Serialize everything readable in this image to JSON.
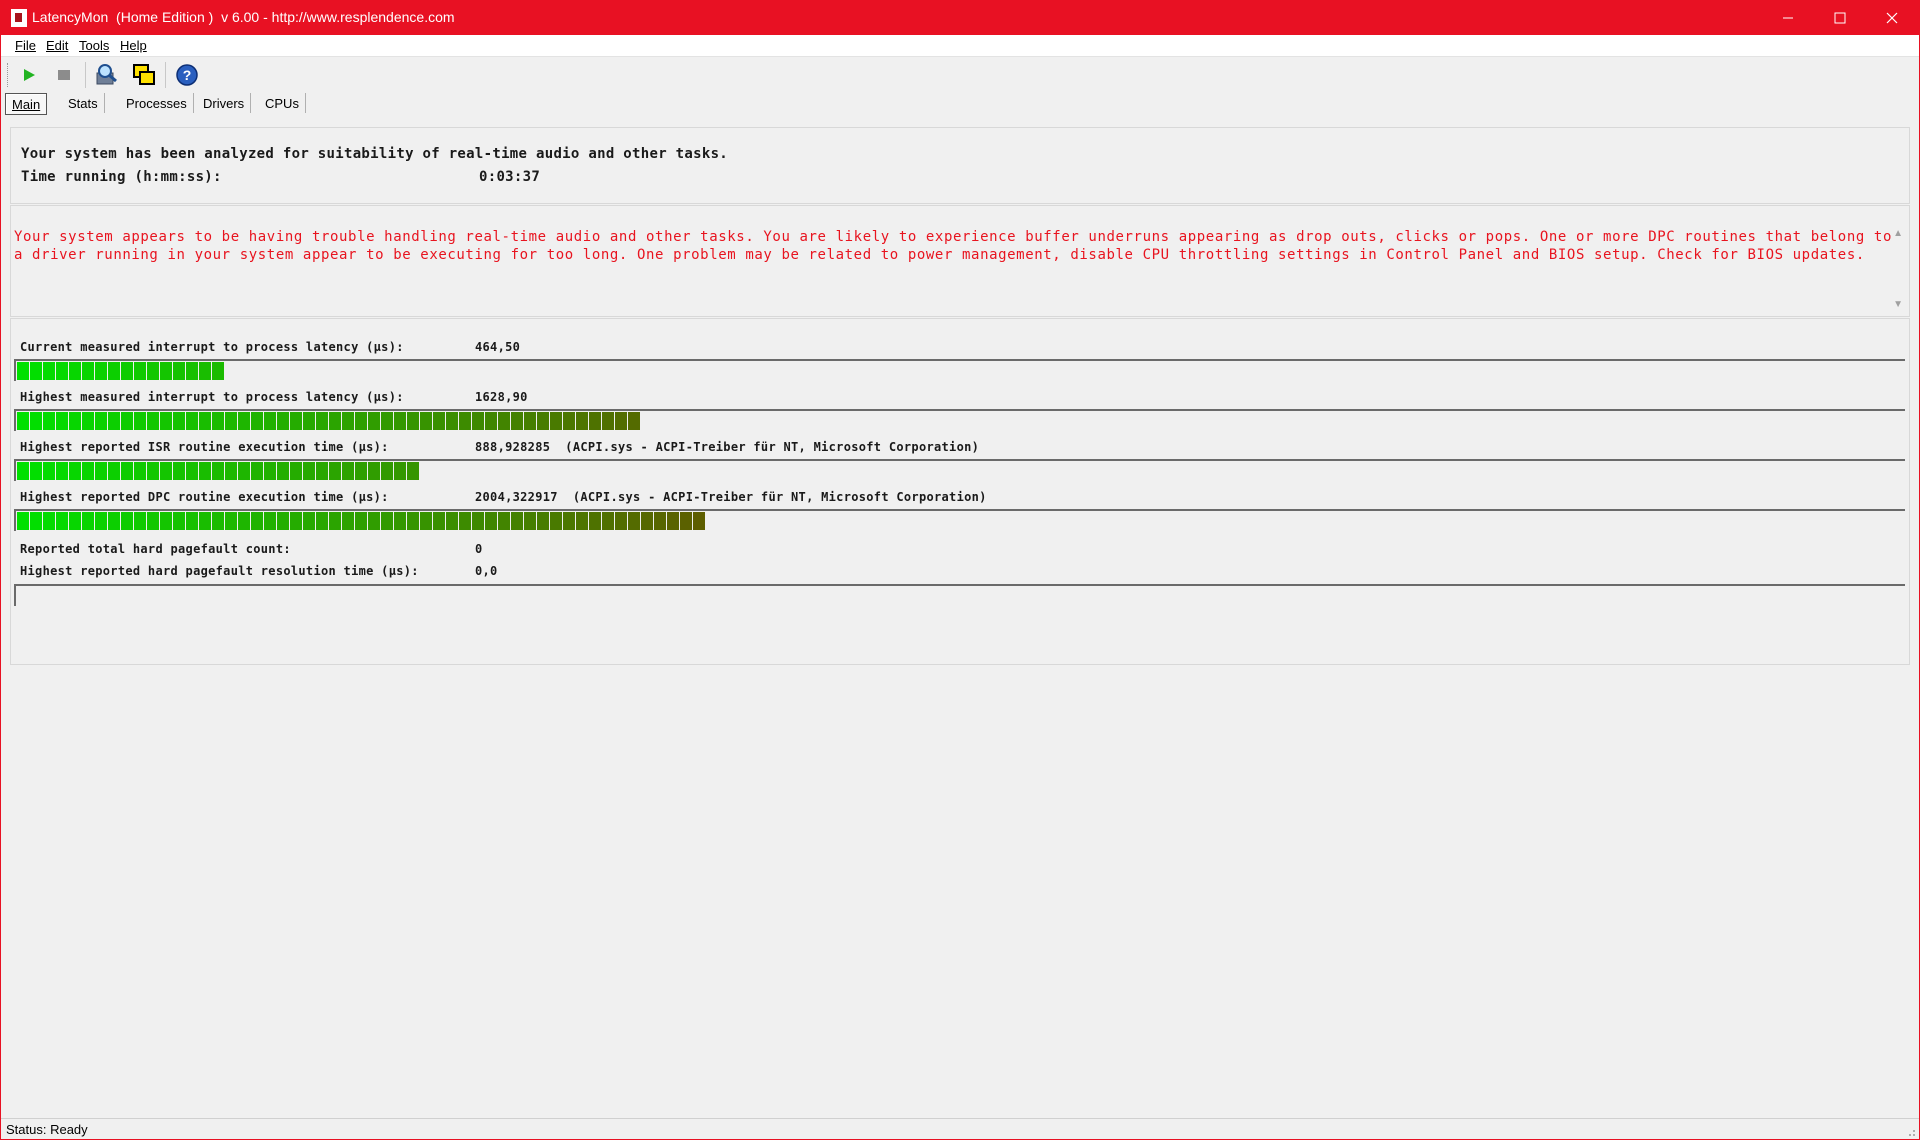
{
  "window": {
    "title": "LatencyMon  (Home Edition )  v 6.00 - http://www.resplendence.com",
    "minimize": "—",
    "maximize": "☐",
    "close": "✕"
  },
  "menu": {
    "file": "File",
    "edit": "Edit",
    "tools": "Tools",
    "help": "Help"
  },
  "toolbar": {
    "icons": [
      "play-icon",
      "stop-icon",
      "search-icon",
      "windows-icon",
      "help-icon"
    ]
  },
  "tabs": [
    "Main",
    "Stats",
    "Processes",
    "Drivers",
    "CPUs"
  ],
  "active_tab": "Main",
  "summary": {
    "line1": "Your system has been analyzed for suitability of real-time audio and other tasks.",
    "time_label": "Time running (h:mm:ss):",
    "time_value": "0:03:37"
  },
  "warning": "Your system appears to be having trouble handling real-time audio and other tasks. You are likely to experience buffer underruns appearing as drop outs, clicks or pops. One or more DPC routines that belong to a driver running in your system appear to be executing for too long. One problem may be related to power management, disable CPU throttling settings in Control Panel and BIOS setup. Check for BIOS updates.",
  "metrics": {
    "current_latency": {
      "label": "Current measured interrupt to process latency (µs):",
      "value": "464,50",
      "level_segments": 16
    },
    "highest_latency": {
      "label": "Highest measured interrupt to process latency (µs):",
      "value": "1628,90",
      "level_segments": 48
    },
    "highest_isr": {
      "label": "Highest reported ISR routine execution time (µs):",
      "value": "888,928285  (ACPI.sys - ACPI-Treiber für NT, Microsoft Corporation)",
      "level_segments": 31
    },
    "highest_dpc": {
      "label": "Highest reported DPC routine execution time (µs):",
      "value": "2004,322917  (ACPI.sys - ACPI-Treiber für NT, Microsoft Corporation)",
      "level_segments": 53
    },
    "pagefault_count": {
      "label": "Reported total hard pagefault count:",
      "value": "0"
    },
    "pagefault_time": {
      "label": "Highest reported hard pagefault resolution time (µs):",
      "value": "0,0",
      "level_segments": 0
    }
  },
  "colors": {
    "titlebar": "#e81123",
    "warning_text": "#e8141f",
    "bar_start": "#00e000",
    "bar_end": "#6b4a00"
  },
  "status": "Status: Ready"
}
